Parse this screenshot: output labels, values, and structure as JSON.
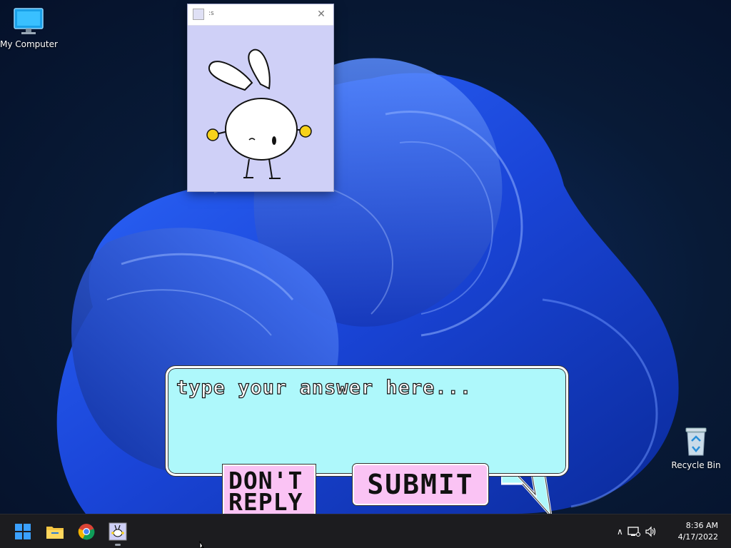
{
  "desktop": {
    "icons": [
      {
        "label": "My Computer",
        "icon": "monitor-icon"
      },
      {
        "label": "Recycle Bin",
        "icon": "recycle-bin-icon"
      }
    ]
  },
  "app_window": {
    "title": ":s",
    "close_glyph": "✕",
    "character": "bunny-character"
  },
  "dialog": {
    "answer_placeholder": "type your answer here...",
    "dont_reply_label": "DON'T REPLY",
    "submit_label": "SUBMIT",
    "colors": {
      "bubble": "#aef8fb",
      "buttons": "#fac3f4"
    }
  },
  "taskbar": {
    "apps": [
      "windows-start-icon",
      "file-explorer-icon",
      "chrome-icon",
      "bunny-app-icon"
    ],
    "tray": {
      "time": "8:36 AM",
      "date": "4/17/2022"
    }
  }
}
